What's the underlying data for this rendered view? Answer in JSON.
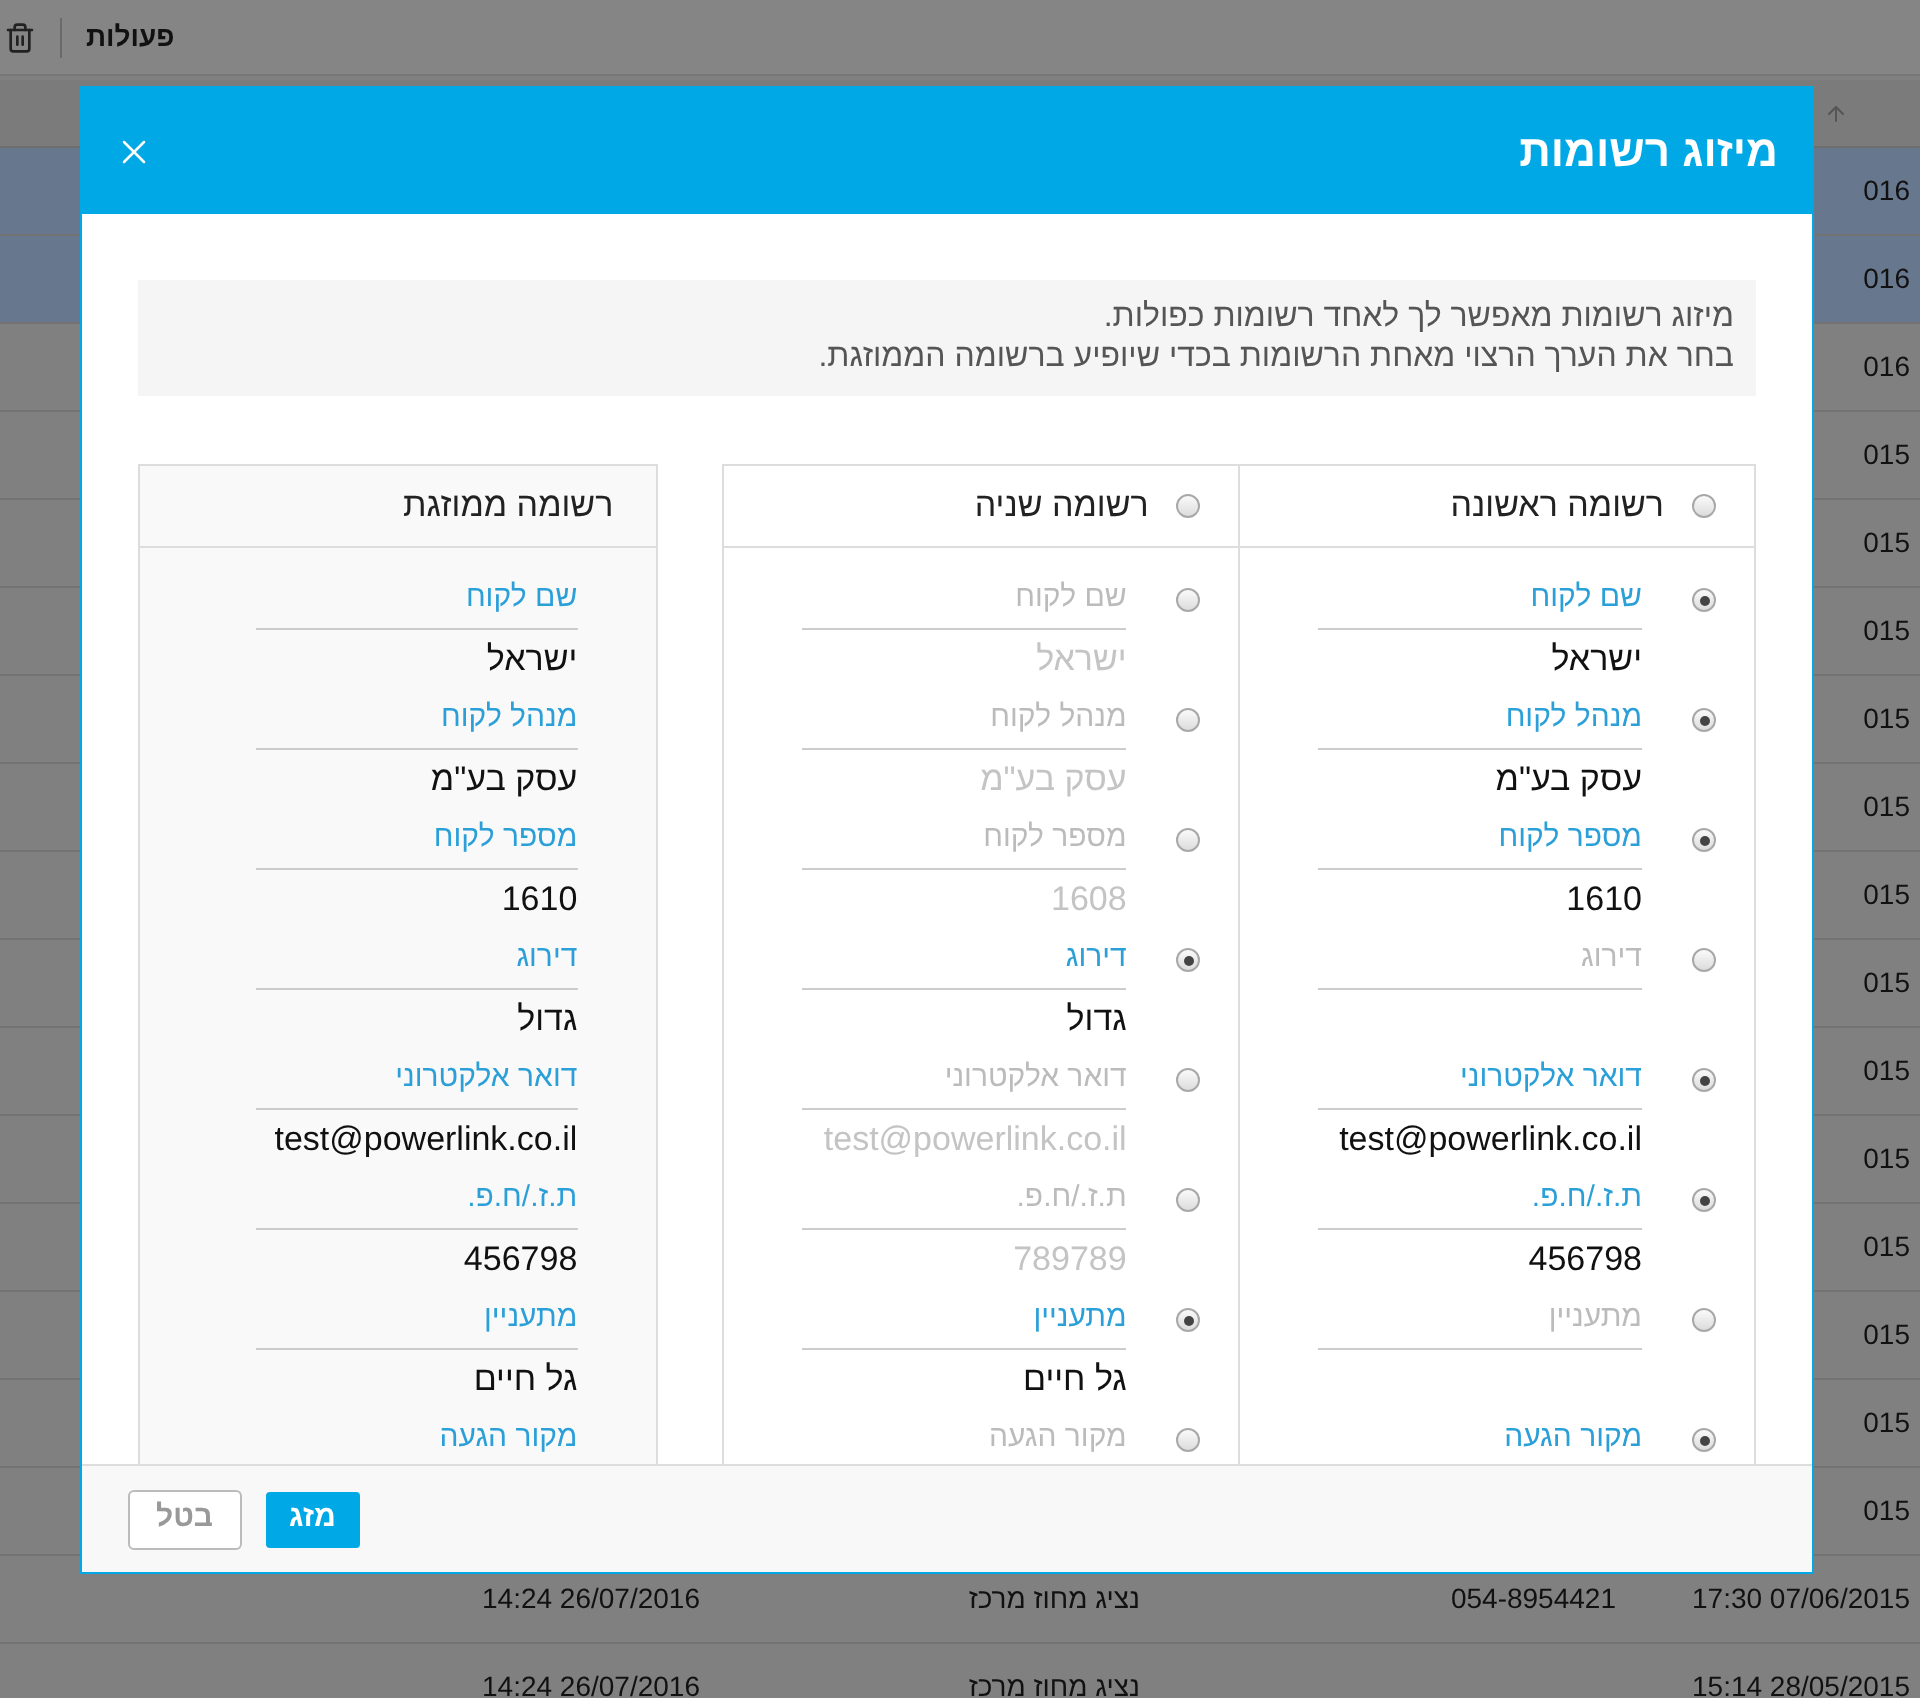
{
  "toolbar": {
    "label": "פעולות"
  },
  "table": {
    "rows": [
      {
        "selected": true,
        "cells": [
          "016"
        ]
      },
      {
        "selected": true,
        "cells": [
          "016"
        ]
      },
      {
        "selected": false,
        "cells": [
          "016"
        ]
      },
      {
        "selected": false,
        "cells": [
          "015"
        ]
      },
      {
        "selected": false,
        "cells": [
          "015"
        ]
      },
      {
        "selected": false,
        "cells": [
          "015"
        ]
      },
      {
        "selected": false,
        "cells": [
          "015"
        ]
      },
      {
        "selected": false,
        "cells": [
          "015"
        ]
      },
      {
        "selected": false,
        "cells": [
          "015"
        ]
      },
      {
        "selected": false,
        "cells": [
          "015"
        ]
      },
      {
        "selected": false,
        "cells": [
          "015"
        ]
      },
      {
        "selected": false,
        "cells": [
          "015"
        ]
      },
      {
        "selected": false,
        "cells": [
          "015"
        ]
      },
      {
        "selected": false,
        "cells": [
          "015"
        ]
      },
      {
        "selected": false,
        "cells": [
          "015"
        ]
      },
      {
        "selected": false,
        "cells": [
          "015"
        ]
      },
      {
        "selected": false,
        "cells": [
          "17:30 07/06/2015",
          "054-8954421",
          "נציג מחוז מרכז",
          "14:24 26/07/2016"
        ]
      },
      {
        "selected": false,
        "cells": [
          "15:14 28/05/2015",
          "",
          "נציג מחוז מרכז",
          "14:24 26/07/2016"
        ]
      }
    ]
  },
  "merge_dialog": {
    "title": "מיזוג רשומות",
    "intro": [
      "מיזוג רשומות מאפשר לך לאחד רשומות כפולות.",
      "בחר את הערך הרצוי מאחת הרשומות בכדי שיופיע ברשומה הממוזגת."
    ],
    "records": [
      {
        "title": "רשומה ראשונה",
        "selected": false,
        "fields": [
          {
            "label": "שם לקוח",
            "value": "ישראל",
            "selected": true
          },
          {
            "label": "מנהל לקוח",
            "value": "עסק בע\"מ",
            "selected": true
          },
          {
            "label": "מספר לקוח",
            "value": "1610",
            "selected": true
          },
          {
            "label": "דירוג",
            "selected": false
          },
          {
            "label": "דואר אלקטרוני",
            "value": "test@powerlink.co.il",
            "selected": true
          },
          {
            "label": "ת.ז./ח.פ.",
            "value": "456798",
            "selected": true
          },
          {
            "label": "מתעניין",
            "selected": false
          },
          {
            "label": "מקור הגעה",
            "selected": true
          }
        ]
      },
      {
        "title": "רשומה שניה",
        "selected": false,
        "fields": [
          {
            "label": "שם לקוח",
            "value": "ישראל",
            "selected": false
          },
          {
            "label": "מנהל לקוח",
            "value": "עסק בע\"מ",
            "selected": false
          },
          {
            "label": "מספר לקוח",
            "value": "1608",
            "selected": false
          },
          {
            "label": "דירוג",
            "value": "גדול",
            "selected": true
          },
          {
            "label": "דואר אלקטרוני",
            "value": "test@powerlink.co.il",
            "selected": false
          },
          {
            "label": "ת.ז./ח.פ.",
            "value": "789789",
            "selected": false
          },
          {
            "label": "מתעניין",
            "value": "גל חיים",
            "selected": true
          },
          {
            "label": "מקור הגעה",
            "selected": false
          }
        ]
      }
    ],
    "merged": {
      "title": "רשומה ממוזגת",
      "fields": [
        {
          "label": "שם לקוח",
          "value": "ישראל"
        },
        {
          "label": "מנהל לקוח",
          "value": "עסק בע\"מ"
        },
        {
          "label": "מספר לקוח",
          "value": "1610"
        },
        {
          "label": "דירוג",
          "value": "גדול"
        },
        {
          "label": "דואר אלקטרוני",
          "value": "test@powerlink.co.il"
        },
        {
          "label": "ת.ז./ח.פ.",
          "value": "456798"
        },
        {
          "label": "מתעניין",
          "value": "גל חיים"
        },
        {
          "label": "מקור הגעה"
        }
      ]
    },
    "buttons": [
      {
        "label": "מזג",
        "kind": "primary"
      },
      {
        "label": "בטל",
        "kind": "secondary"
      }
    ]
  }
}
